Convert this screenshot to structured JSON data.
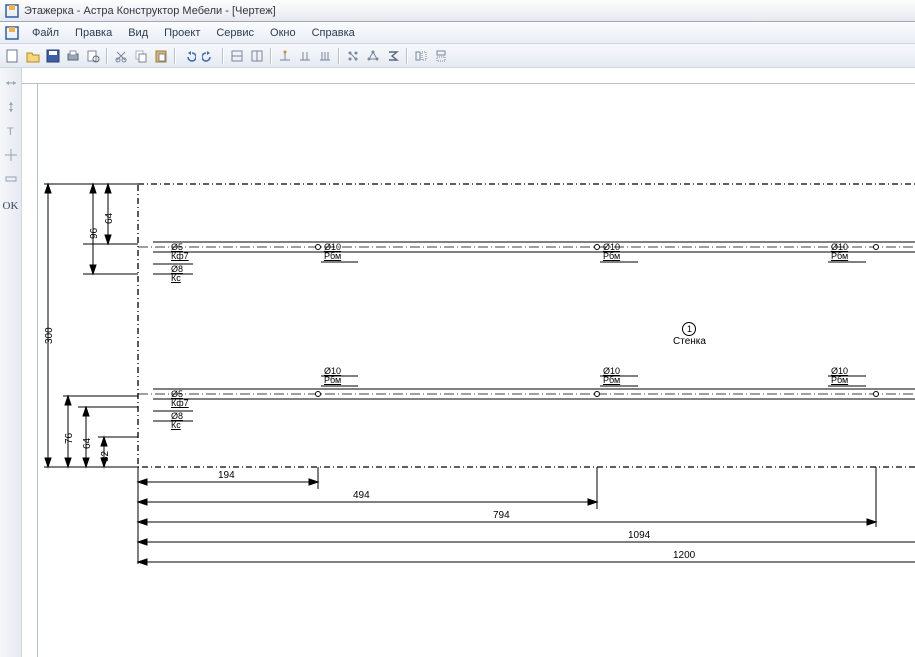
{
  "window": {
    "title": "Этажерка - Астра Конструктор Мебели - [Чертеж]"
  },
  "menu": {
    "items": [
      "Файл",
      "Правка",
      "Вид",
      "Проект",
      "Сервис",
      "Окно",
      "Справка"
    ]
  },
  "toolbar": {
    "groups": [
      [
        "new",
        "open",
        "save",
        "print",
        "preview"
      ],
      [
        "cut",
        "copy",
        "paste"
      ],
      [
        "undo",
        "redo"
      ],
      [
        "grid1",
        "grid2"
      ],
      [
        "dim1",
        "dim2",
        "dim3"
      ],
      [
        "tree",
        "network",
        "sigma"
      ],
      [
        "flip-h",
        "flip-v"
      ]
    ]
  },
  "sidebar": {
    "tools": [
      "arrow-h",
      "arrow-v",
      "text",
      "move",
      "ruler"
    ],
    "ok": "OK"
  },
  "drawing": {
    "dims_v": {
      "d300": "300",
      "d96": "96",
      "d64t": "64",
      "d76": "76",
      "d64b": "64",
      "d32": "32"
    },
    "dims_h": {
      "d194": "194",
      "d494": "494",
      "d794": "794",
      "d1094": "1094",
      "d1200": "1200"
    },
    "holes": {
      "set_top": {
        "d5": "Ø5",
        "k7": "Кф7",
        "d8": "Ø8",
        "kc": "Кс"
      },
      "set_bottom": {
        "d5": "Ø5",
        "k7": "Кф7",
        "d8": "Ø8",
        "kc": "Кс"
      },
      "rbm": {
        "d10": "Ø10",
        "label": "Рбм"
      }
    },
    "part": {
      "num": "1",
      "name": "Стенка"
    }
  }
}
